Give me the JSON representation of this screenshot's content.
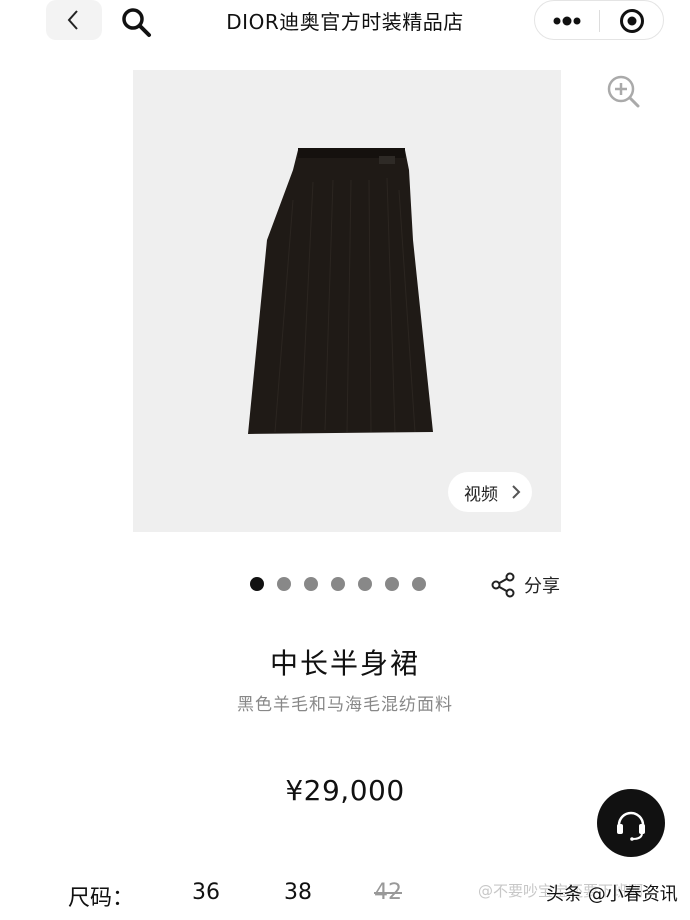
{
  "header": {
    "title": "DIOR迪奥官方时装精品店",
    "icons": [
      "back-icon",
      "search-icon",
      "more-icon",
      "close-miniprogram-icon"
    ]
  },
  "gallery": {
    "video_label": "视频",
    "image_count": 7,
    "active_index": 0,
    "share_label": "分享"
  },
  "product": {
    "name": "中长半身裙",
    "description": "黑色羊毛和马海毛混纺面料",
    "price": "¥29,000"
  },
  "sizes": {
    "label": "尺码：",
    "options": [
      {
        "value": "36",
        "available": true
      },
      {
        "value": "38",
        "available": true
      },
      {
        "value": "42",
        "available": false
      }
    ]
  },
  "watermark": {
    "text": "@不要吵宝宝还要下班啊",
    "source": "头条 @小春资讯"
  },
  "colors": {
    "accent": "#111111",
    "muted_text": "#888888",
    "image_bg": "#efefef"
  }
}
